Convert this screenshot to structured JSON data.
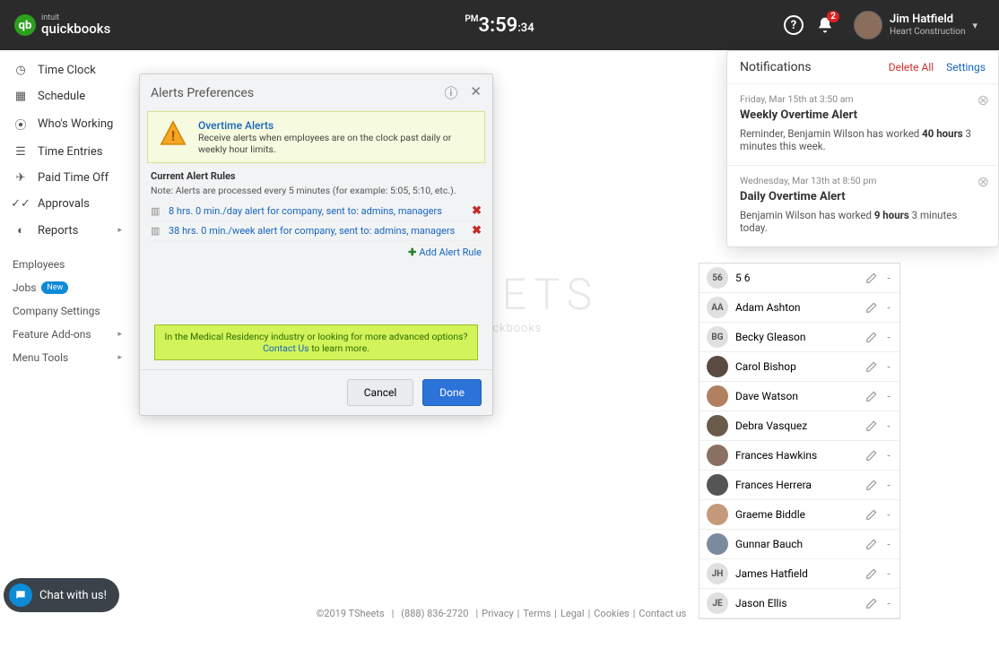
{
  "brand": {
    "intuit": "intuit",
    "product": "quickbooks",
    "logo_letter": "qb"
  },
  "clock": {
    "ampm": "PM",
    "time": "3:59",
    "seconds": ":34"
  },
  "top": {
    "notif_count": "2",
    "user_name": "Jim Hatfield",
    "user_company": "Heart Construction"
  },
  "sidebar": {
    "items": [
      {
        "label": "Time Clock",
        "icon": "clock"
      },
      {
        "label": "Schedule",
        "icon": "calendar"
      },
      {
        "label": "Who's Working",
        "icon": "pin"
      },
      {
        "label": "Time Entries",
        "icon": "list"
      },
      {
        "label": "Paid Time Off",
        "icon": "plane"
      },
      {
        "label": "Approvals",
        "icon": "check"
      },
      {
        "label": "Reports",
        "icon": "pie",
        "caret": true
      }
    ],
    "groups": [
      {
        "label": "Employees"
      },
      {
        "label": "Jobs",
        "new": "New"
      },
      {
        "label": "Company Settings"
      },
      {
        "label": "Feature Add-ons",
        "caret": true
      },
      {
        "label": "Menu Tools",
        "caret": true
      }
    ]
  },
  "modal": {
    "title": "Alerts Preferences",
    "banner_title": "Overtime Alerts",
    "banner_sub": "Receive alerts when employees are on the clock past daily or weekly hour limits.",
    "rules_title": "Current Alert Rules",
    "rules_note": "Note: Alerts are processed every 5 minutes (for example: 5:05, 5:10, etc.).",
    "rules": [
      {
        "text": "8 hrs. 0 min./day alert for company, sent to: admins, managers"
      },
      {
        "text": "38 hrs. 0 min./week alert for company, sent to: admins, managers"
      }
    ],
    "add_rule": "Add Alert Rule",
    "green_pre": "In the Medical Residency industry or looking for more advanced options? ",
    "green_link": "Contact Us",
    "green_post": " to learn more.",
    "cancel": "Cancel",
    "done": "Done"
  },
  "notifications": {
    "title": "Notifications",
    "delete_all": "Delete All",
    "settings": "Settings",
    "items": [
      {
        "date": "Friday, Mar 15th at 3:50 am",
        "title": "Weekly Overtime Alert",
        "body_pre": "Reminder, Benjamin Wilson has worked ",
        "bold": "40 hours",
        "body_post": " 3 minutes this week."
      },
      {
        "date": "Wednesday, Mar 13th at 8:50 pm",
        "title": "Daily Overtime Alert",
        "body_pre": "Benjamin Wilson has worked ",
        "bold": "9 hours",
        "body_post": " 3 minutes today."
      }
    ]
  },
  "employees": [
    {
      "initials": "56",
      "name": "5 6"
    },
    {
      "initials": "AA",
      "name": "Adam Ashton"
    },
    {
      "initials": "BG",
      "name": "Becky Gleason"
    },
    {
      "name": "Carol Bishop",
      "photo": true
    },
    {
      "name": "Dave Watson",
      "photo": true
    },
    {
      "name": "Debra Vasquez",
      "photo": true
    },
    {
      "name": "Frances Hawkins",
      "photo": true
    },
    {
      "name": "Frances Herrera",
      "photo": true
    },
    {
      "name": "Graeme Biddle",
      "photo": true
    },
    {
      "name": "Gunnar Bauch",
      "photo": true
    },
    {
      "initials": "JH",
      "name": "James Hatfield"
    },
    {
      "initials": "JE",
      "name": "Jason Ellis"
    }
  ],
  "footer": {
    "copyright": "©2019 TSheets",
    "phone": "(888) 836-2720",
    "links": [
      "Privacy",
      "Terms",
      "Legal",
      "Cookies",
      "Contact us"
    ]
  },
  "chat": "Chat with us!",
  "bg": {
    "logo": "SHEETS",
    "sub": "by quickbooks"
  }
}
